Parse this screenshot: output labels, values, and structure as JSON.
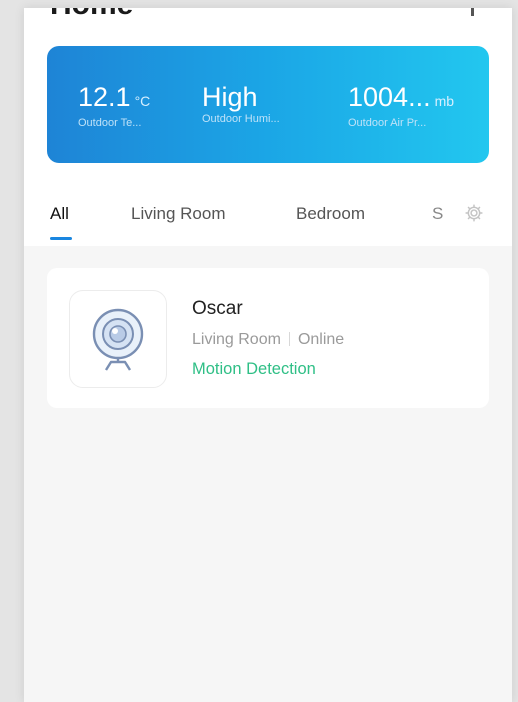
{
  "header": {
    "title": "Home"
  },
  "weather": {
    "temperature": {
      "value": "12.1",
      "unit": "°C",
      "label": "Outdoor Te..."
    },
    "humidity": {
      "value": "High",
      "unit": "",
      "label": "Outdoor Humi..."
    },
    "pressure": {
      "value": "1004...",
      "unit": "mb",
      "label": "Outdoor Air Pr..."
    }
  },
  "tabs": [
    {
      "label": "All",
      "active": true
    },
    {
      "label": "Living Room"
    },
    {
      "label": "Bedroom"
    },
    {
      "label": "S"
    }
  ],
  "device": {
    "name": "Oscar",
    "room": "Living Room",
    "connection": "Online",
    "status": "Motion Detection",
    "icon": "camera-icon"
  },
  "colors": {
    "card_gradient_start": "#1e84d6",
    "card_gradient_end": "#22c7ef",
    "accent_tab": "#1a86e0",
    "status_green": "#2fbf86"
  }
}
